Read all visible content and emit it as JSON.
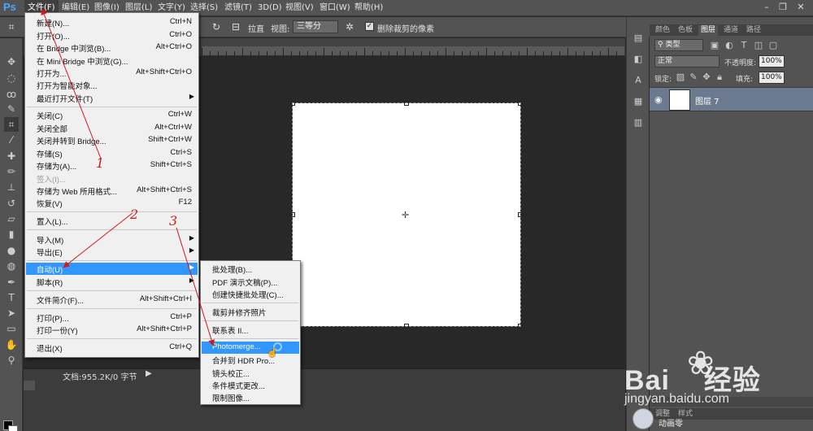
{
  "app": {
    "logo": "Ps"
  },
  "menubar": {
    "items": [
      "文件(F)",
      "编辑(E)",
      "图像(I)",
      "图层(L)",
      "文字(Y)",
      "选择(S)",
      "滤镜(T)",
      "3D(D)",
      "视图(V)",
      "窗口(W)",
      "帮助(H)"
    ]
  },
  "options_bar": {
    "straighten": "拉直",
    "view_label": "视图:",
    "view_value": "三等分",
    "delete_cropped": "删除裁剪的像素"
  },
  "file_menu": {
    "items": [
      {
        "label": "新建(N)...",
        "shortcut": "Ctrl+N"
      },
      {
        "label": "打开(O)...",
        "shortcut": "Ctrl+O"
      },
      {
        "label": "在 Bridge 中浏览(B)...",
        "shortcut": "Alt+Ctrl+O"
      },
      {
        "label": "在 Mini Bridge 中浏览(G)...",
        "shortcut": ""
      },
      {
        "label": "打开为...",
        "shortcut": "Alt+Shift+Ctrl+O"
      },
      {
        "label": "打开为智能对象...",
        "shortcut": ""
      },
      {
        "label": "最近打开文件(T)",
        "shortcut": ""
      },
      {
        "label": "关闭(C)",
        "shortcut": "Ctrl+W"
      },
      {
        "label": "关闭全部",
        "shortcut": "Alt+Ctrl+W"
      },
      {
        "label": "关闭并转到 Bridge...",
        "shortcut": "Shift+Ctrl+W"
      },
      {
        "label": "存储(S)",
        "shortcut": "Ctrl+S"
      },
      {
        "label": "存储为(A)...",
        "shortcut": "Shift+Ctrl+S"
      },
      {
        "label": "签入(I)...",
        "shortcut": ""
      },
      {
        "label": "存储为 Web 所用格式...",
        "shortcut": "Alt+Shift+Ctrl+S"
      },
      {
        "label": "恢复(V)",
        "shortcut": "F12"
      },
      {
        "label": "置入(L)...",
        "shortcut": ""
      },
      {
        "label": "导入(M)",
        "shortcut": ""
      },
      {
        "label": "导出(E)",
        "shortcut": ""
      },
      {
        "label": "自动(U)",
        "shortcut": ""
      },
      {
        "label": "脚本(R)",
        "shortcut": ""
      },
      {
        "label": "文件简介(F)...",
        "shortcut": "Alt+Shift+Ctrl+I"
      },
      {
        "label": "打印(P)...",
        "shortcut": "Ctrl+P"
      },
      {
        "label": "打印一份(Y)",
        "shortcut": "Alt+Shift+Ctrl+P"
      },
      {
        "label": "退出(X)",
        "shortcut": "Ctrl+Q"
      }
    ]
  },
  "automate_submenu": {
    "items": [
      "批处理(B)...",
      "PDF 演示文稿(P)...",
      "创建快捷批处理(C)...",
      "裁剪并修齐照片",
      "联系表 II...",
      "Photomerge...",
      "合并到 HDR Pro...",
      "镜头校正...",
      "条件模式更改...",
      "限制图像..."
    ]
  },
  "status_bar": {
    "doc_info": "文档:955.2K/0 字节"
  },
  "layers_panel": {
    "tabs": [
      "颜色",
      "色板",
      "图层",
      "通道",
      "路径"
    ],
    "kind": "类型",
    "blend_mode": "正常",
    "opacity_label": "不透明度:",
    "opacity_value": "100%",
    "lock_label": "锁定:",
    "fill_label": "填充:",
    "fill_value": "100%",
    "layer_name": "图层 7",
    "bottom_tabs": [
      "调整",
      "样式"
    ]
  },
  "annotations": {
    "n1": "1",
    "n2": "2",
    "n3": "3"
  },
  "watermark": {
    "logo": "Bai",
    "logo_tail": "经验",
    "url": "jingyan.baidu.com",
    "user": "动画零"
  },
  "colors": {
    "menu_highlight": "#3296ff",
    "annotation": "#d11a1a",
    "ui_bg": "#535353"
  }
}
